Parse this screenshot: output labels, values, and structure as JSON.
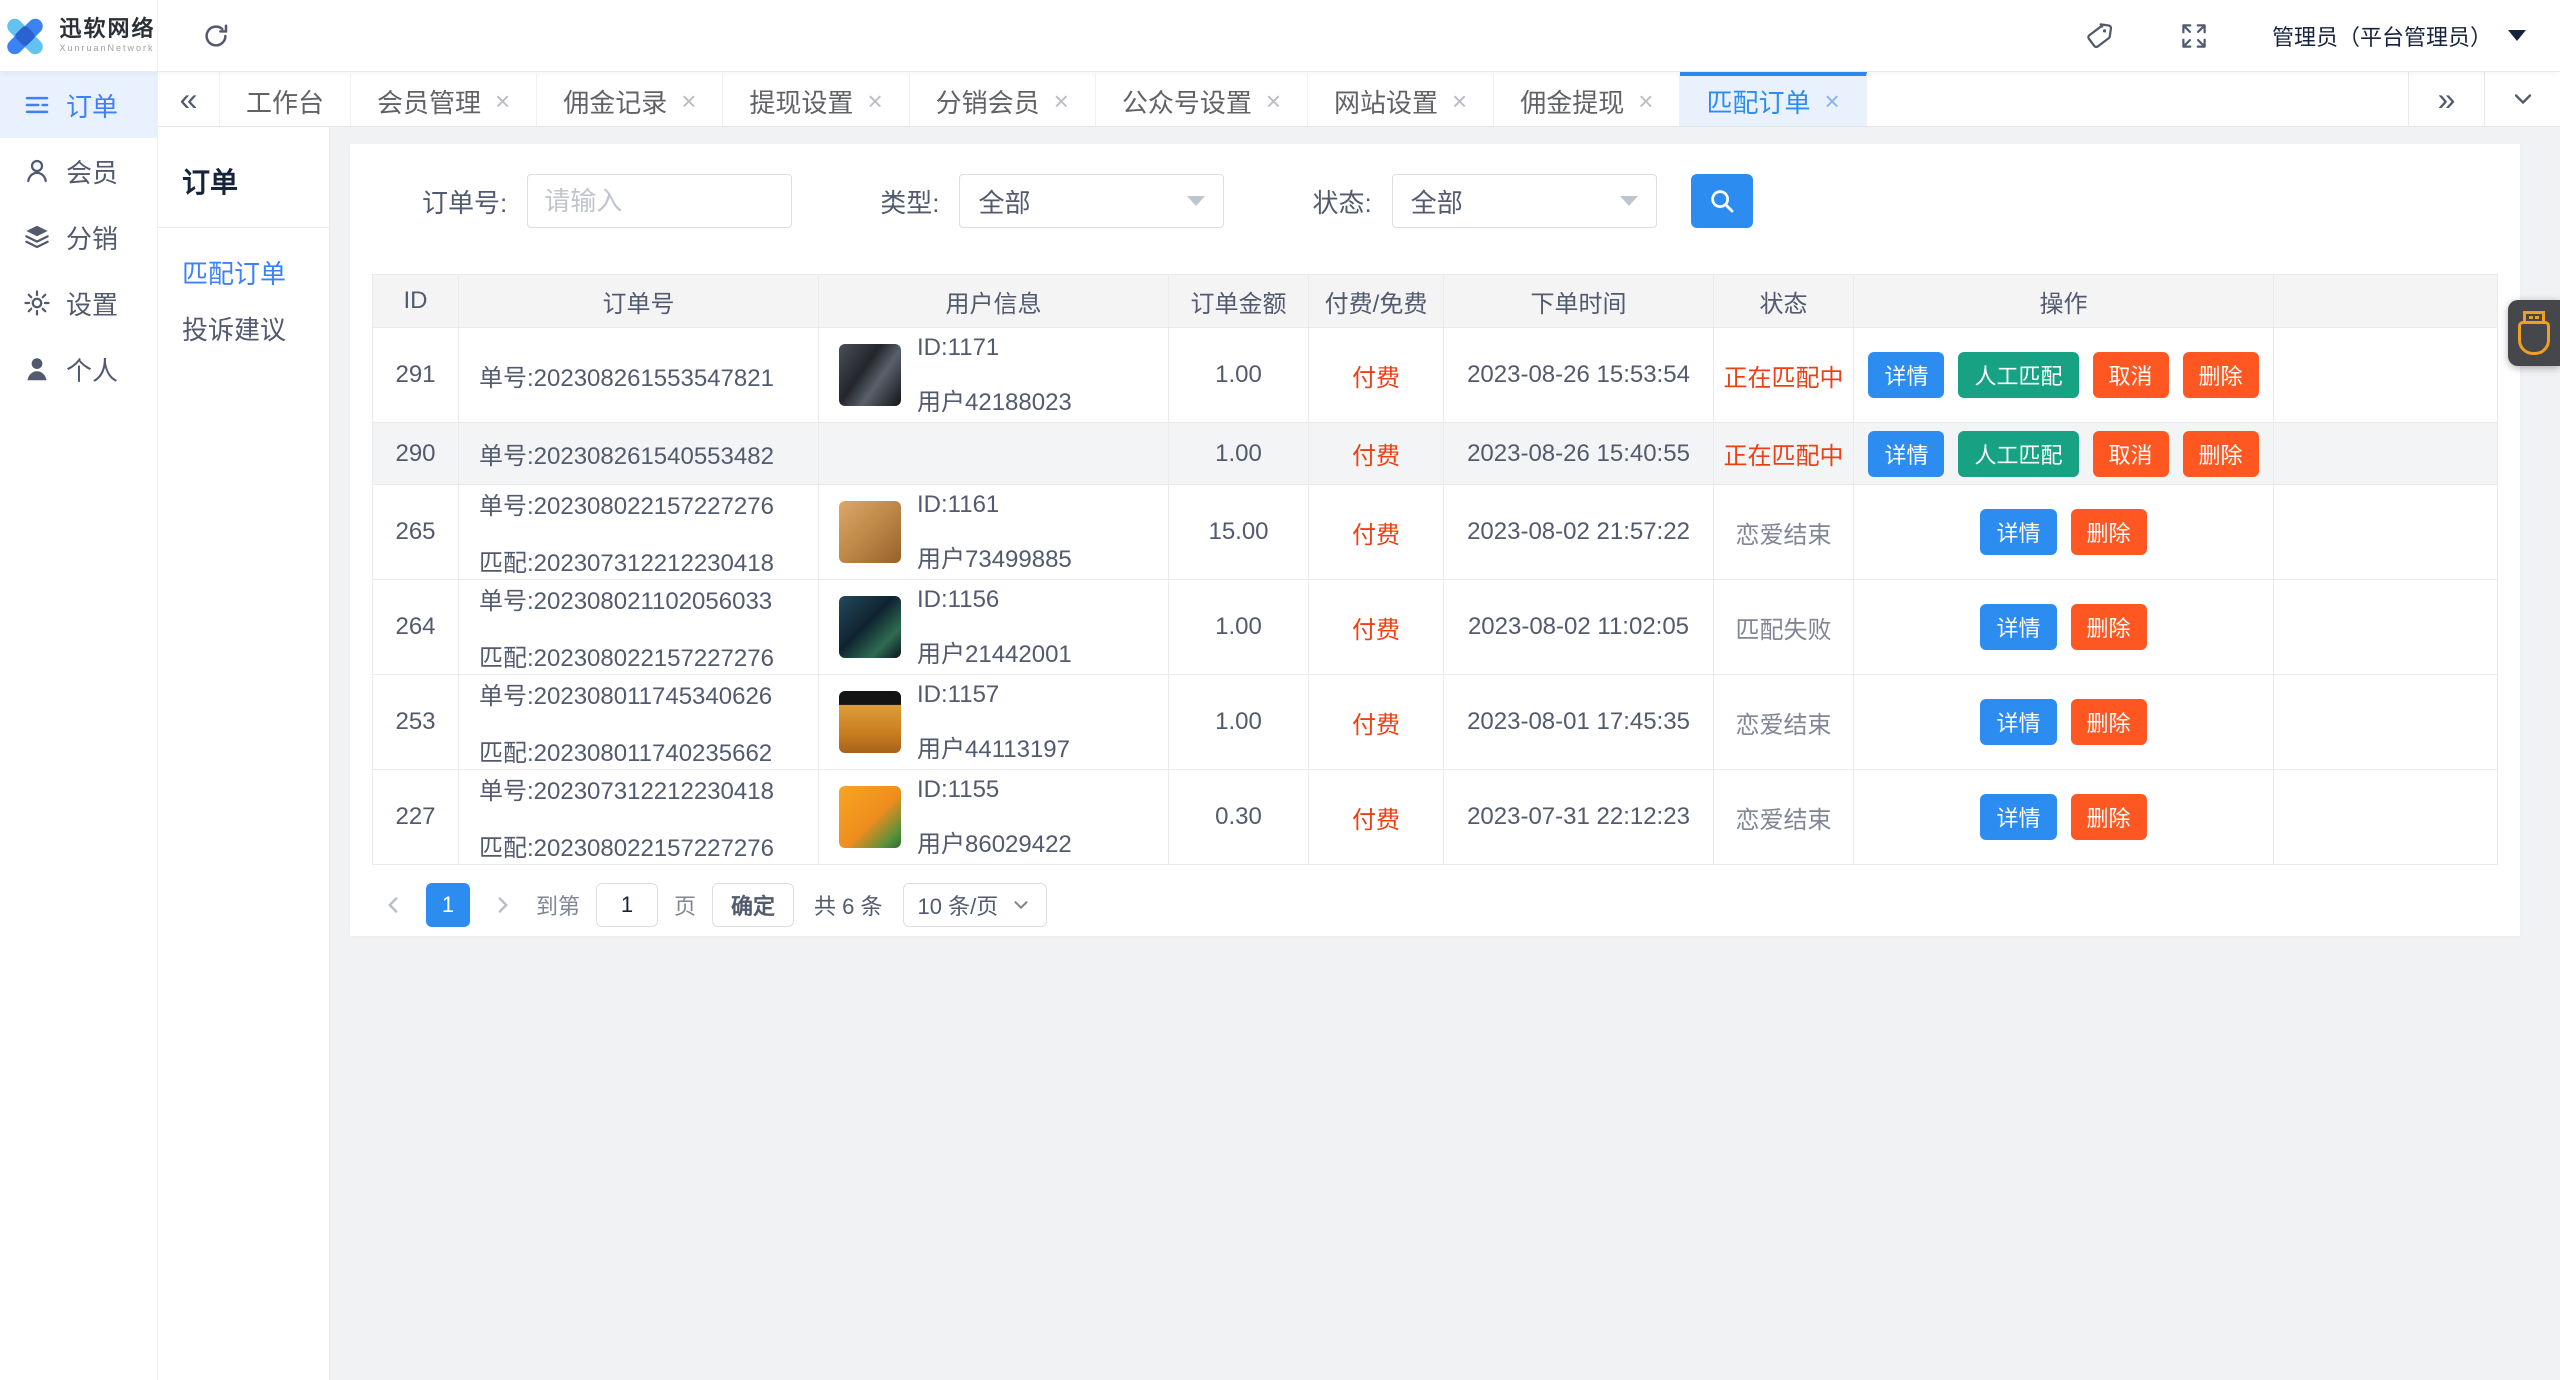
{
  "topbar": {
    "logo_title": "迅软网络",
    "logo_subtitle": "XunruanNetwork",
    "user": "管理员（平台管理员）",
    "icons": [
      "refresh-icon",
      "tag-icon",
      "fullscreen-icon",
      "caret-down-icon"
    ]
  },
  "sidebar": {
    "items": [
      {
        "key": "orders",
        "label": "订单",
        "icon": "order-list-icon",
        "active": true
      },
      {
        "key": "members",
        "label": "会员",
        "icon": "member-icon",
        "active": false
      },
      {
        "key": "distribution",
        "label": "分销",
        "icon": "layers-icon",
        "active": false
      },
      {
        "key": "settings",
        "label": "设置",
        "icon": "gear-icon",
        "active": false
      },
      {
        "key": "profile",
        "label": "个人",
        "icon": "person-icon",
        "active": false
      }
    ]
  },
  "tabs": [
    {
      "label": "工作台",
      "closable": false,
      "active": false
    },
    {
      "label": "会员管理",
      "closable": true,
      "active": false
    },
    {
      "label": "佣金记录",
      "closable": true,
      "active": false
    },
    {
      "label": "提现设置",
      "closable": true,
      "active": false
    },
    {
      "label": "分销会员",
      "closable": true,
      "active": false
    },
    {
      "label": "公众号设置",
      "closable": true,
      "active": false
    },
    {
      "label": "网站设置",
      "closable": true,
      "active": false
    },
    {
      "label": "佣金提现",
      "closable": true,
      "active": false
    },
    {
      "label": "匹配订单",
      "closable": true,
      "active": true
    }
  ],
  "submenu": {
    "title": "订单",
    "items": [
      {
        "key": "match-orders",
        "label": "匹配订单",
        "active": true
      },
      {
        "key": "complaints",
        "label": "投诉建议",
        "active": false
      }
    ]
  },
  "filters": {
    "order_no": {
      "label": "订单号:",
      "placeholder": "请输入"
    },
    "type": {
      "label": "类型:",
      "value": "全部"
    },
    "status": {
      "label": "状态:",
      "value": "全部"
    },
    "search_icon": "search-icon"
  },
  "table": {
    "columns": [
      "ID",
      "订单号",
      "用户信息",
      "订单金额",
      "付费/免费",
      "下单时间",
      "状态",
      "操作",
      ""
    ],
    "rows": [
      {
        "id": "291",
        "order_no": "单号:202308261553547821",
        "match_no": "",
        "user": {
          "uid": "ID:1171",
          "uname": "用户42188023",
          "avatar": "portrait-photo"
        },
        "amount": "1.00",
        "fee": "付费",
        "time": "2023-08-26 15:53:54",
        "status": "正在匹配中",
        "status_style": "red",
        "highlight": false,
        "actions": [
          {
            "name": "detail-button",
            "label": "详情",
            "style": "blue"
          },
          {
            "name": "manual-match-button",
            "label": "人工匹配",
            "style": "green"
          },
          {
            "name": "cancel-button",
            "label": "取消",
            "style": "orange"
          },
          {
            "name": "delete-button",
            "label": "删除",
            "style": "orange"
          }
        ]
      },
      {
        "id": "290",
        "order_no": "单号:202308261540553482",
        "match_no": "",
        "user": null,
        "amount": "1.00",
        "fee": "付费",
        "time": "2023-08-26 15:40:55",
        "status": "正在匹配中",
        "status_style": "red",
        "highlight": true,
        "actions": [
          {
            "name": "detail-button",
            "label": "详情",
            "style": "blue"
          },
          {
            "name": "manual-match-button",
            "label": "人工匹配",
            "style": "green"
          },
          {
            "name": "cancel-button",
            "label": "取消",
            "style": "orange"
          },
          {
            "name": "delete-button",
            "label": "删除",
            "style": "orange"
          }
        ]
      },
      {
        "id": "265",
        "order_no": "单号:202308022157227276",
        "match_no": "匹配:202307312212230418",
        "user": {
          "uid": "ID:1161",
          "uname": "用户73499885",
          "avatar": "dog-photo"
        },
        "amount": "15.00",
        "fee": "付费",
        "time": "2023-08-02 21:57:22",
        "status": "恋爱结束",
        "status_style": "grey",
        "highlight": false,
        "actions": [
          {
            "name": "detail-button",
            "label": "详情",
            "style": "blue"
          },
          {
            "name": "delete-button",
            "label": "删除",
            "style": "orange"
          }
        ]
      },
      {
        "id": "264",
        "order_no": "单号:202308021102056033",
        "match_no": "匹配:202308022157227276",
        "user": {
          "uid": "ID:1156",
          "uname": "用户21442001",
          "avatar": "game-screenshot"
        },
        "amount": "1.00",
        "fee": "付费",
        "time": "2023-08-02 11:02:05",
        "status": "匹配失败",
        "status_style": "grey",
        "highlight": false,
        "actions": [
          {
            "name": "detail-button",
            "label": "详情",
            "style": "blue"
          },
          {
            "name": "delete-button",
            "label": "删除",
            "style": "orange"
          }
        ]
      },
      {
        "id": "253",
        "order_no": "单号:202308011745340626",
        "match_no": "匹配:202308011740235662",
        "user": {
          "uid": "ID:1157",
          "uname": "用户44113197",
          "avatar": "monkey-photo"
        },
        "amount": "1.00",
        "fee": "付费",
        "time": "2023-08-01 17:45:35",
        "status": "恋爱结束",
        "status_style": "grey",
        "highlight": false,
        "actions": [
          {
            "name": "detail-button",
            "label": "详情",
            "style": "blue"
          },
          {
            "name": "delete-button",
            "label": "删除",
            "style": "orange"
          }
        ]
      },
      {
        "id": "227",
        "order_no": "单号:202307312212230418",
        "match_no": "匹配:202308022157227276",
        "user": {
          "uid": "ID:1155",
          "uname": "用户86029422",
          "avatar": "garfield-cartoon"
        },
        "amount": "0.30",
        "fee": "付费",
        "time": "2023-07-31 22:12:23",
        "status": "恋爱结束",
        "status_style": "grey",
        "highlight": false,
        "actions": [
          {
            "name": "detail-button",
            "label": "详情",
            "style": "blue"
          },
          {
            "name": "delete-button",
            "label": "删除",
            "style": "orange"
          }
        ]
      }
    ]
  },
  "pagination": {
    "prev_icon": "chevron-left-icon",
    "current": "1",
    "next_icon": "chevron-right-icon",
    "goto_prefix": "到第",
    "goto_value": "1",
    "goto_suffix": "页",
    "confirm": "确定",
    "total": "共 6 条",
    "page_size": "10 条/页",
    "page_size_icon": "chevron-down-icon"
  },
  "floating_widget": {
    "icon": "usb-icon"
  },
  "colors": {
    "primary": "#2d8cf0",
    "success_button": "#17a283",
    "danger_button": "#ff5722",
    "red_text": "#ed3f14",
    "sidebar_active": "#3d80f8",
    "widget_icon": "#f0a020"
  }
}
